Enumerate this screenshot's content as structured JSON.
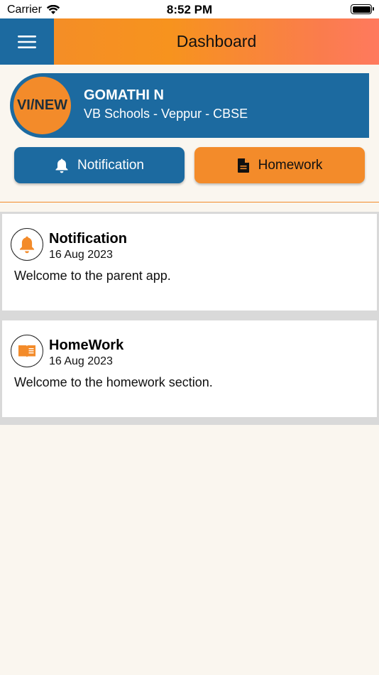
{
  "status_bar": {
    "carrier": "Carrier",
    "time": "8:52 PM"
  },
  "app_bar": {
    "title": "Dashboard",
    "menu_icon": "hamburger-menu-icon"
  },
  "profile": {
    "class_badge": "VI/NEW",
    "name": "GOMATHI N",
    "school": "VB Schools - Veppur - CBSE"
  },
  "actions": {
    "notification_label": "Notification",
    "homework_label": "Homework"
  },
  "feed": {
    "items": [
      {
        "icon": "bell-icon",
        "title": "Notification",
        "date": "16 Aug 2023",
        "message": "Welcome to the parent app."
      },
      {
        "icon": "book-icon",
        "title": "HomeWork",
        "date": "16 Aug 2023",
        "message": "Welcome to the homework section."
      }
    ]
  },
  "colors": {
    "primary_blue": "#1c6aa0",
    "accent_orange": "#f38b2a",
    "background": "#faf6ef"
  }
}
